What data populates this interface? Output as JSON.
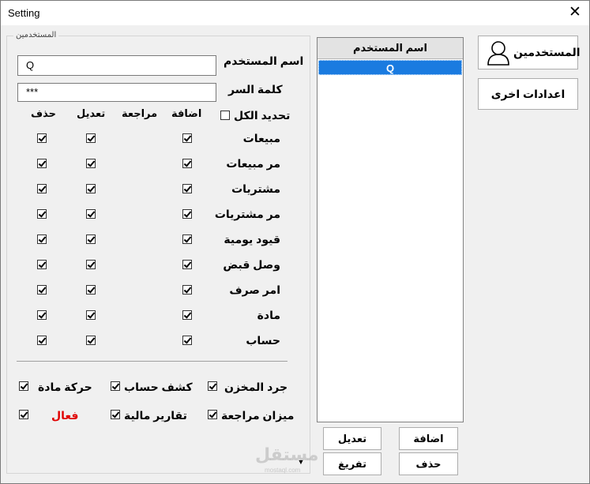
{
  "window": {
    "title": "Setting",
    "close_glyph": "✕"
  },
  "users_frame": {
    "caption": "المستخدمين"
  },
  "user_fields": {
    "username_label": "اسم المستخدم",
    "username_value": "Q",
    "password_label": "كلمة السر",
    "password_value": "***"
  },
  "permissions": {
    "select_all_label": "تحديد الكل",
    "select_all_checked": false,
    "columns": {
      "add": "اضافة",
      "review": "مراجعة",
      "edit": "تعديل",
      "delete": "حذف"
    },
    "rows": [
      {
        "label": "مبيعات",
        "add": true,
        "edit": true,
        "delete": true
      },
      {
        "label": "مر مبيعات",
        "add": true,
        "edit": true,
        "delete": true
      },
      {
        "label": "مشتريات",
        "add": true,
        "edit": true,
        "delete": true
      },
      {
        "label": "مر مشتريات",
        "add": true,
        "edit": true,
        "delete": true
      },
      {
        "label": "قيود يومية",
        "add": true,
        "edit": true,
        "delete": true
      },
      {
        "label": "وصل قبض",
        "add": true,
        "edit": true,
        "delete": true
      },
      {
        "label": "امر صرف",
        "add": true,
        "edit": true,
        "delete": true
      },
      {
        "label": "مادة",
        "add": true,
        "edit": true,
        "delete": true
      },
      {
        "label": "حساب",
        "add": true,
        "edit": true,
        "delete": true
      }
    ]
  },
  "reports": [
    {
      "label": "جرد المخزن",
      "checked": true
    },
    {
      "label": "كشف حساب",
      "checked": true
    },
    {
      "label": "حركة مادة",
      "checked": true
    },
    {
      "label": "ميزان مراجعة",
      "checked": true
    },
    {
      "label": "تقارير مالية",
      "checked": true
    },
    {
      "label": "فعال",
      "checked": true,
      "color": "#e00000"
    }
  ],
  "users_list": {
    "header": "اسم المستخدم",
    "items": [
      "Q"
    ]
  },
  "actions": {
    "add": "اضافة",
    "edit": "تعديل",
    "delete": "حذف",
    "clear": "تفريغ"
  },
  "side_nav": {
    "users": "المستخدمين",
    "other_settings": "اعدادات اخرى"
  },
  "scroll_glyph": "▼",
  "watermark": {
    "brand": "مستقل",
    "domain": "mostaql.com"
  },
  "colors": {
    "selection": "#1a7be0",
    "active_label": "#e00000"
  }
}
